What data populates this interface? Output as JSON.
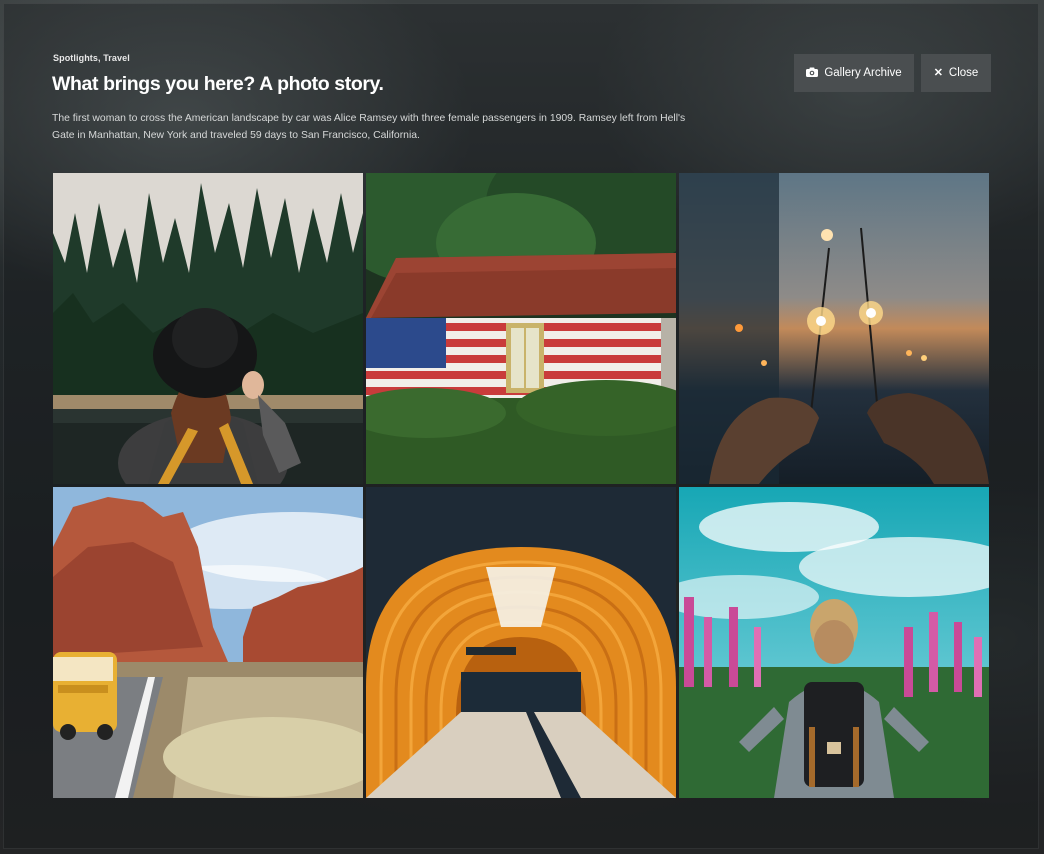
{
  "story": {
    "category": "Spotlights, Travel",
    "title": "What brings you here? A photo story.",
    "description": "The first woman to cross the American landscape by car was Alice Ramsey with three female passengers in 1909. Ramsey left from Hell's Gate in Manhattan, New York and traveled 59 days to San Francisco, California."
  },
  "actions": {
    "archive_label": "Gallery Archive",
    "archive_icon": "camera-icon",
    "close_label": "Close",
    "close_icon": "close-icon"
  },
  "gallery": {
    "photos": [
      {
        "subject": "woman-in-hat-forest"
      },
      {
        "subject": "flag-painted-barn"
      },
      {
        "subject": "sparklers-at-dusk"
      },
      {
        "subject": "desert-road-van"
      },
      {
        "subject": "orange-tunnel"
      },
      {
        "subject": "backpacker-in-flowers"
      }
    ]
  },
  "colors": {
    "button_bg": "#4a4e50",
    "text_primary": "#ffffff"
  }
}
